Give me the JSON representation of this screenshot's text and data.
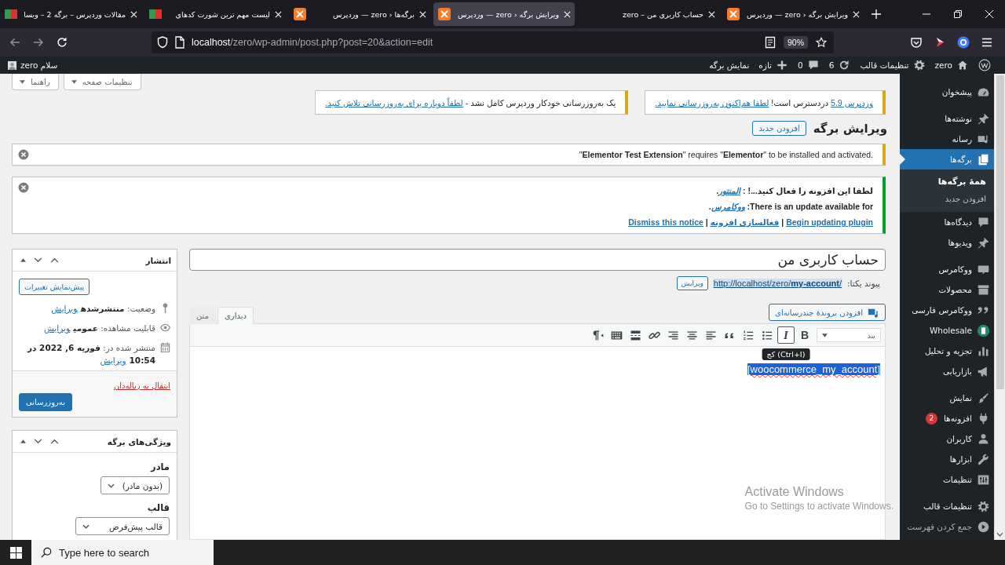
{
  "browser": {
    "tabs": [
      {
        "title": "ویرایش برگه ‹ zero — وردپرس",
        "selected": false
      },
      {
        "title": "حساب کاربری من – zero",
        "selected": false
      },
      {
        "title": "ویرایش برگه ‹ zero — وردپرس",
        "selected": true
      },
      {
        "title": "برگه‌ها ‹ zero — وردپرس",
        "selected": false
      },
      {
        "title": "لیست مهم ترین شورت کدهای",
        "selected": false
      },
      {
        "title": "مقالات وردپرس – برگه 2 – وبسا",
        "selected": false
      }
    ],
    "url": {
      "host": "localhost",
      "path": "/zero/wp-admin/post.php?post=20&action=edit"
    },
    "zoom": "90%"
  },
  "admin_bar": {
    "site": "zero",
    "customize": "تنظیمات قالب",
    "updates": "6",
    "comments": "0",
    "new": "تازه",
    "view": "نمایش برگه",
    "greeting": "سلام zero"
  },
  "screen_options": [
    "تنظیمات صفحه",
    "راهنما"
  ],
  "update_notices": [
    {
      "kind": "warning",
      "parts": [
        {
          "kind": "link",
          "text": "وردپرس 5.9"
        },
        {
          "kind": "text",
          "text": " دردسترس است! "
        },
        {
          "kind": "link",
          "text": "لطفا هم‌اکنون به‌روزرسانی نمایید."
        }
      ]
    },
    {
      "kind": "warning",
      "parts": [
        {
          "kind": "text",
          "text": "یک به‌روزرسانی خودکار وردپرس کامل نشد - "
        },
        {
          "kind": "link",
          "text": "لطفاً دوباره برای به‌روزرسانی تلاش کنید."
        }
      ]
    }
  ],
  "page_title": "ویرایش برگه",
  "add_new": "افزودن جدید",
  "notices": [
    {
      "kind": "warning",
      "dismissible": true,
      "lines": [
        [
          {
            "kind": "text",
            "text": "\"**Elementor Test Extension**\" requires \"**Elementor**\" to be installed and activated."
          }
        ]
      ]
    },
    {
      "kind": "success",
      "dismissible": true,
      "lines": [
        [
          {
            "kind": "text",
            "text": "لطفا این افزونه را فعال کنید...! : "
          },
          {
            "kind": "em_link",
            "text": "المنتور"
          },
          {
            "kind": "text",
            "text": "."
          }
        ],
        [
          {
            "kind": "text",
            "text": "There is an update available for: "
          },
          {
            "kind": "em_link",
            "text": "ووکامرس"
          },
          {
            "kind": "text",
            "text": "."
          }
        ],
        [
          {
            "kind": "link",
            "text": "Begin updating plugin"
          },
          {
            "kind": "text",
            "text": " | "
          },
          {
            "kind": "link",
            "text": "فعالسازی افزونه"
          },
          {
            "kind": "text",
            "text": " | "
          },
          {
            "kind": "link",
            "text": "Dismiss this notice"
          }
        ]
      ]
    }
  ],
  "post": {
    "title": "حساب کاربری من",
    "permalink_label": "پیوند یکتا:",
    "permalink": {
      "text": "http://localhost/zero/**my-account**/",
      "highlighted": true
    },
    "permalink_edit": "ویرایش",
    "add_media": "افزودن پروندهٔ چندرسانه‌ای",
    "editor_tabs": [
      {
        "label": "دیداری",
        "selected": true
      },
      {
        "label": "متن",
        "selected": false
      }
    ],
    "format": "بند",
    "tools": [
      {
        "label": "B",
        "hovered": false
      },
      {
        "label": "I",
        "hovered": true
      },
      {
        "hovered": false
      },
      {
        "hovered": false
      },
      {
        "hovered": false
      },
      {
        "hovered": false
      },
      {
        "hovered": false
      },
      {
        "hovered": false
      },
      {
        "hovered": false
      },
      {
        "hovered": false
      },
      {
        "hovered": false
      },
      {
        "hovered": false
      }
    ],
    "tooltip": "کج (Ctrl+I)",
    "content": {
      "text": "[woocommerce_my_account]",
      "highlighted": true,
      "misspelled": true
    }
  },
  "publish": {
    "title": "انتشار",
    "preview": "پیش‌نمایش تغییرات",
    "rows": [
      {
        "text": "وضعیت: **منتشرشده**",
        "action": "ویرایش"
      },
      {
        "text": "قابلیت مشاهده: **عمومی**",
        "action": "ویرایش"
      },
      {
        "text": "منتشر شده در: **فوریه 6, 2022 در 10:54**",
        "action": "ویرایش"
      }
    ],
    "trash": "انتقال به زباله‌دان",
    "update": "به‌روزرسانی"
  },
  "attributes": {
    "title": "ویژگی‌های برگه",
    "fields": [
      {
        "label": "مادر",
        "value": "(بدون مادر)"
      },
      {
        "label": "قالب",
        "value": "قالب پیش‌فرض"
      }
    ]
  },
  "sidebar": {
    "groups": [
      [
        {
          "label": "پیشخوان",
          "selected": false
        }
      ],
      [
        {
          "label": "نوشته‌ها",
          "selected": false
        },
        {
          "label": "رسانه",
          "selected": false
        },
        {
          "label": "برگه‌ها",
          "selected": true,
          "children": [
            {
              "label": "همهٔ برگه‌ها",
              "selected": true
            },
            {
              "label": "افزودن جدید",
              "selected": false
            }
          ]
        },
        {
          "label": "دیدگاه‌ها",
          "selected": false
        },
        {
          "label": "ویدیوها",
          "selected": false
        }
      ],
      [
        {
          "label": "ووکامرس",
          "selected": false
        },
        {
          "label": "محصولات",
          "selected": false
        },
        {
          "label": "ووکامرس فارسی",
          "selected": false
        },
        {
          "label": "Wholesale",
          "selected": false
        },
        {
          "label": "تجزیه و تحلیل",
          "selected": false
        },
        {
          "label": "بازاریابی",
          "selected": false
        }
      ],
      [
        {
          "label": "نمایش",
          "selected": false
        },
        {
          "label": "افزونه‌ها",
          "selected": false,
          "badge": "2"
        },
        {
          "label": "کاربران",
          "selected": false
        },
        {
          "label": "ابزارها",
          "selected": false
        },
        {
          "label": "تنظیمات",
          "selected": false
        }
      ],
      [
        {
          "label": "تنظیمات قالب",
          "selected": false
        }
      ]
    ],
    "collapse": "جمع کردن فهرست"
  },
  "activation": {
    "title": "Activate Windows",
    "text": "Go to Settings to activate Windows."
  },
  "taskbar": {
    "search_placeholder": "Type here to search"
  }
}
